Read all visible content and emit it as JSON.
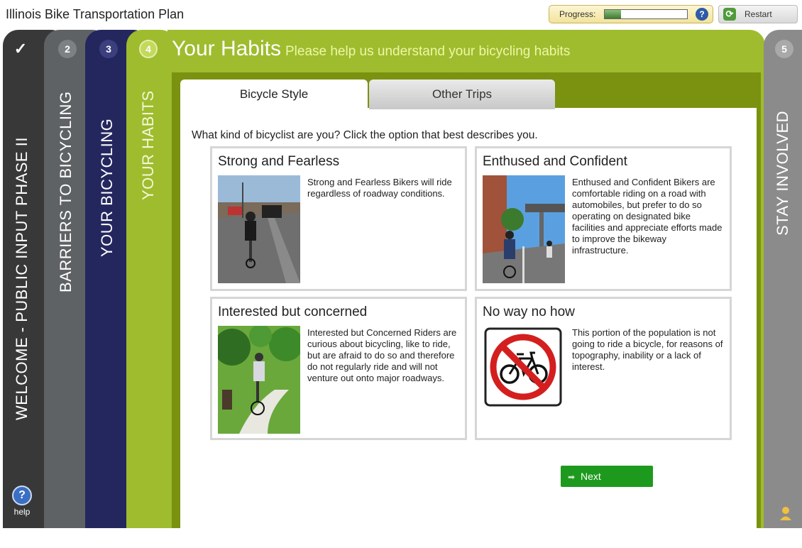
{
  "app": {
    "title": "Illinois Bike Transportation Plan"
  },
  "progress": {
    "label": "Progress:",
    "value": 0.2,
    "help_glyph": "?"
  },
  "restart": {
    "label": "Restart",
    "icon": "refresh-icon"
  },
  "side_tabs": [
    {
      "number": "✓",
      "label": "WELCOME - PUBLIC INPUT PHASE II",
      "color": "#383838"
    },
    {
      "number": "2",
      "label": "BARRIERS TO BICYCLING",
      "color": "#5f6265"
    },
    {
      "number": "3",
      "label": "YOUR BICYCLING",
      "color": "#24275e"
    },
    {
      "number": "4",
      "label": "YOUR HABITS",
      "color": "#9ebc2e"
    },
    {
      "number": "5",
      "label": "STAY INVOLVED",
      "color": "#8b8b8b"
    }
  ],
  "help": {
    "glyph": "?",
    "label": "help"
  },
  "main": {
    "title": "Your Habits",
    "subtitle": "Please help us understand your bicycling habits",
    "tabs": [
      {
        "label": "Bicycle Style",
        "active": true
      },
      {
        "label": "Other Trips",
        "active": false
      }
    ],
    "question": "What kind of bicyclist are you? Click the option that best describes you.",
    "options": [
      {
        "title": "Strong and Fearless",
        "description": "Strong and Fearless Bikers will ride regardless of roadway conditions."
      },
      {
        "title": "Enthused and Confident",
        "description": "Enthused and Confident Bikers are comfortable riding on a road with automobiles, but prefer to do so operating on designated bike facilities and appreciate efforts made to improve the bikeway infrastructure."
      },
      {
        "title": "Interested but concerned",
        "description": "Interested but Concerned Riders are curious about bicycling, like to ride, but are afraid to do so and therefore do not regularly ride and will not venture out onto major roadways."
      },
      {
        "title": "No way no how",
        "description": "This portion of the population is not going to ride a bicycle, for reasons of topography, inability or a lack of interest."
      }
    ],
    "next_label": "Next"
  },
  "colors": {
    "accent_green": "#9ebc2e",
    "next_green": "#1d9a1d",
    "help_blue": "#3a6fc4"
  }
}
